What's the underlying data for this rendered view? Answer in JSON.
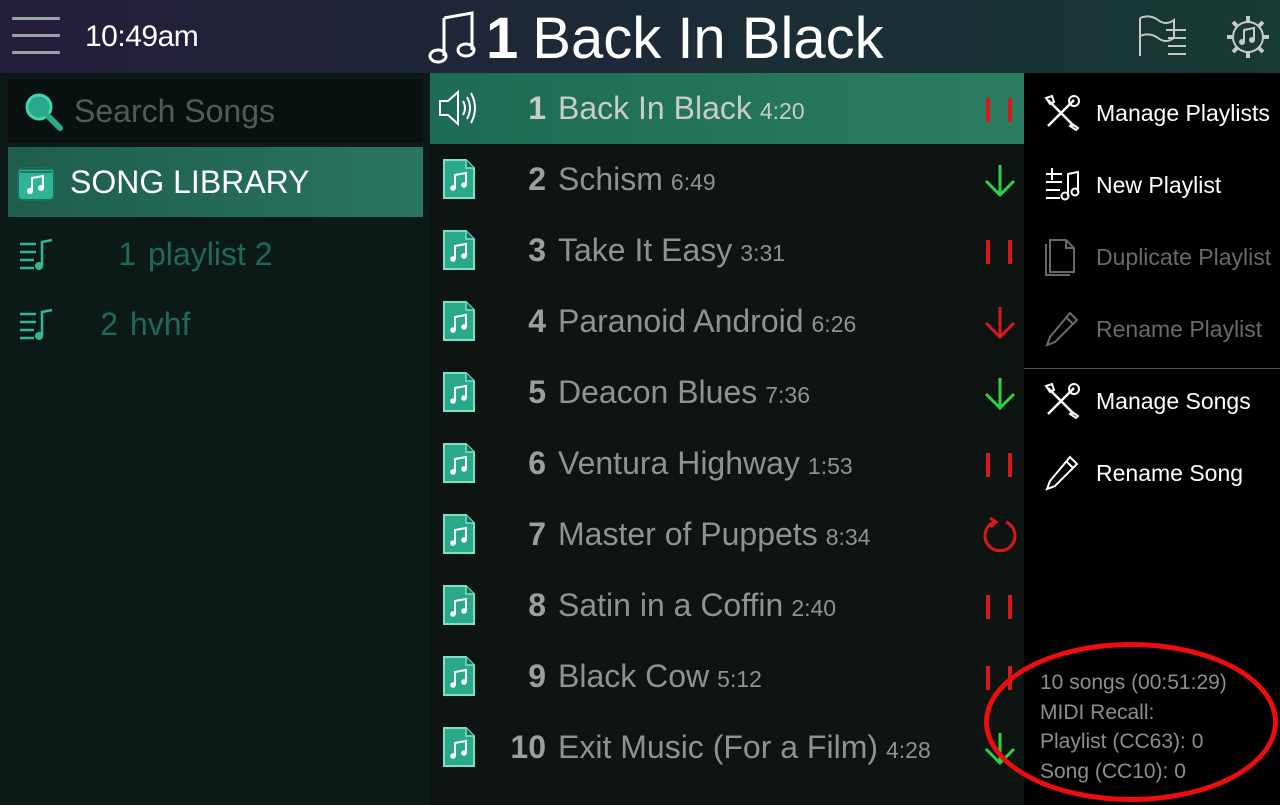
{
  "header": {
    "time": "10:49am",
    "current_song_number": "1",
    "current_song_title": "Back In Black"
  },
  "search": {
    "placeholder": "Search Songs",
    "value": ""
  },
  "library": {
    "label": "SONG LIBRARY"
  },
  "playlists": [
    {
      "number": "1",
      "name": "playlist 2"
    },
    {
      "number": "2",
      "name": "hvhf"
    }
  ],
  "songs": [
    {
      "number": "1",
      "title": "Back In Black",
      "duration": "4:20",
      "status": "pause",
      "active": true
    },
    {
      "number": "2",
      "title": "Schism",
      "duration": "6:49",
      "status": "down-green"
    },
    {
      "number": "3",
      "title": "Take It Easy",
      "duration": "3:31",
      "status": "pause"
    },
    {
      "number": "4",
      "title": "Paranoid Android",
      "duration": "6:26",
      "status": "down-red"
    },
    {
      "number": "5",
      "title": "Deacon Blues",
      "duration": "7:36",
      "status": "down-green"
    },
    {
      "number": "6",
      "title": "Ventura Highway",
      "duration": "1:53",
      "status": "pause"
    },
    {
      "number": "7",
      "title": "Master of Puppets",
      "duration": "8:34",
      "status": "loop"
    },
    {
      "number": "8",
      "title": "Satin in a Coffin",
      "duration": "2:40",
      "status": "pause"
    },
    {
      "number": "9",
      "title": "Black Cow",
      "duration": "5:12",
      "status": "pause"
    },
    {
      "number": "10",
      "title": "Exit Music (For a Film)",
      "duration": "4:28",
      "status": "down-green"
    }
  ],
  "menu": {
    "manage_playlists": "Manage Playlists",
    "new_playlist": "New Playlist",
    "duplicate_playlist": "Duplicate Playlist",
    "rename_playlist": "Rename Playlist",
    "manage_songs": "Manage Songs",
    "rename_song": "Rename Song"
  },
  "info": {
    "song_count": "10 songs (00:51:29)",
    "midi_recall": "MIDI Recall:",
    "playlist_cc": "Playlist (CC63): 0",
    "song_cc": "Song (CC10): 0"
  },
  "colors": {
    "accent_green": "#2a7d62",
    "status_red": "#d8191c",
    "status_green": "#2fcf46",
    "annotation_red": "#ee0d0d"
  },
  "icons": {
    "menu": "hamburger-icon",
    "title": "music-note-icon",
    "setlist": "flags-list-icon",
    "settings": "gear-music-icon",
    "search": "search-icon",
    "library": "library-folder-icon",
    "playlist": "playlist-icon",
    "song_file": "music-file-icon",
    "speaker": "speaker-icon",
    "manage": "tools-icon",
    "new_playlist": "new-playlist-icon",
    "duplicate": "duplicate-icon",
    "rename": "pencil-icon"
  }
}
